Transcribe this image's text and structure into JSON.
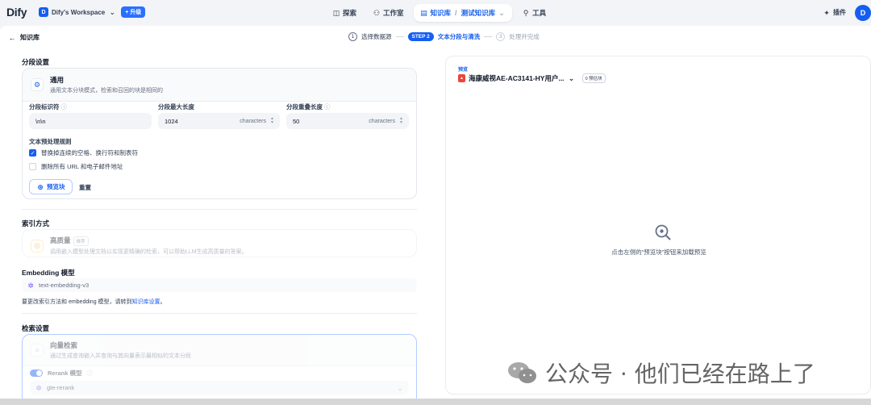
{
  "app": {
    "logo": "Dify",
    "workspace_initial": "D",
    "workspace_name": "Dify's Workspace",
    "upgrade": "+ 升级"
  },
  "nav": {
    "explore": "探索",
    "studio": "工作室",
    "knowledge": "知识库",
    "knowledge_current": "测试知识库",
    "tools": "工具",
    "plugins": "插件",
    "avatar": "D"
  },
  "header": {
    "back": "知识库",
    "steps": [
      {
        "num": "1",
        "label": "选择数据源"
      },
      {
        "num": "STEP 2",
        "label": "文本分段与清洗"
      },
      {
        "num": "3",
        "label": "处理并完成"
      }
    ]
  },
  "segment": {
    "section_title": "分段设置",
    "mode_title": "通用",
    "mode_desc": "通用文本分块模式，检索和召回的块是相同的",
    "separator_label": "分段标识符",
    "separator_value": "\\n\\n",
    "max_len_label": "分段最大长度",
    "max_len_value": "1024",
    "overlap_label": "分段重叠长度",
    "overlap_value": "50",
    "unit": "characters",
    "rules_title": "文本预处理规则",
    "rule1": "替换掉连续的空格、换行符和制表符",
    "rule1_checked": true,
    "rule2": "删除所有 URL 和电子邮件地址",
    "rule2_checked": false,
    "preview_btn": "预览块",
    "reset_btn": "重置"
  },
  "index": {
    "section_title": "索引方式",
    "hq_title": "高质量",
    "hq_tag": "推荐",
    "hq_desc": "调用嵌入模型处理文档以实现更精确的检索，可以帮助LLM生成高质量的答案。"
  },
  "embedding": {
    "section_title": "Embedding 模型",
    "model": "text-embedding-v3",
    "note_prefix": "要更改索引方法和 embedding 模型，请转到",
    "note_link": "知识库设置",
    "note_suffix": "。"
  },
  "retrieval": {
    "section_title": "检索设置",
    "vector_title": "向量检索",
    "vector_desc": "通过生成查询嵌入并查询与其向量表示最相似的文本分段",
    "rerank_label": "Rerank 模型",
    "rerank_model": "gte-rerank"
  },
  "preview": {
    "label": "预览",
    "doc_name": "海康威视AE-AC3141-HY用户...",
    "count": "0 预估块",
    "empty": "点击左侧的“预览块”按钮来加载预览"
  },
  "watermark": "公众号 · 他们已经在路上了",
  "colors": {
    "accent": "#155eef",
    "border": "#e4e7ec"
  }
}
